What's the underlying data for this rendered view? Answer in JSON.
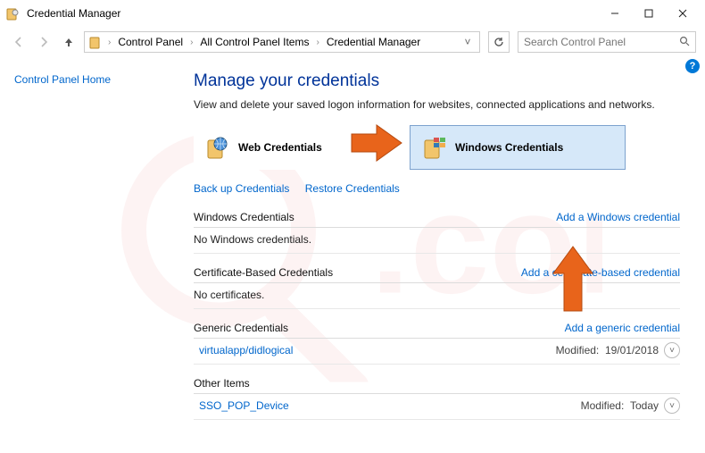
{
  "window": {
    "title": "Credential Manager"
  },
  "breadcrumb": {
    "items": [
      "Control Panel",
      "All Control Panel Items",
      "Credential Manager"
    ]
  },
  "search": {
    "placeholder": "Search Control Panel"
  },
  "sidebar": {
    "home": "Control Panel Home"
  },
  "main": {
    "heading": "Manage your credentials",
    "description": "View and delete your saved logon information for websites, connected applications and networks."
  },
  "tabs": {
    "web": "Web Credentials",
    "windows": "Windows Credentials"
  },
  "actions": {
    "backup": "Back up Credentials",
    "restore": "Restore Credentials"
  },
  "sections": {
    "windows": {
      "title": "Windows Credentials",
      "add": "Add a Windows credential",
      "empty": "No Windows credentials."
    },
    "cert": {
      "title": "Certificate-Based Credentials",
      "add": "Add a certificate-based credential",
      "empty": "No certificates."
    },
    "generic": {
      "title": "Generic Credentials",
      "add": "Add a generic credential",
      "items": [
        {
          "name": "virtualapp/didlogical",
          "modified_label": "Modified:",
          "modified_value": "19/01/2018"
        }
      ]
    },
    "other": {
      "title": "Other Items",
      "items": [
        {
          "name": "SSO_POP_Device",
          "modified_label": "Modified:",
          "modified_value": "Today"
        }
      ]
    }
  },
  "help": {
    "symbol": "?"
  }
}
